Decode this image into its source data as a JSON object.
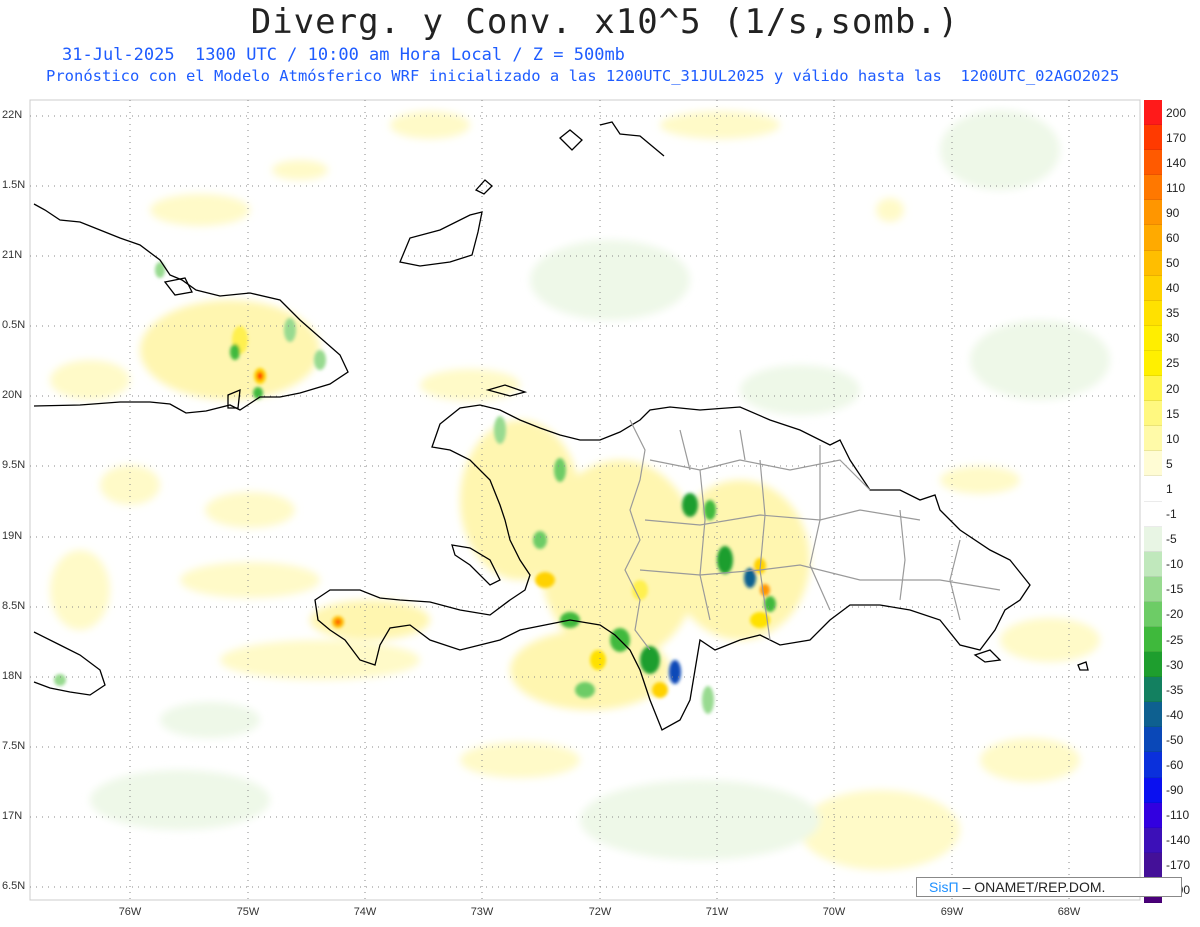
{
  "title": "Diverg. y Conv. x10^5 (1/s,somb.)",
  "subtitle_line1": "31-Jul-2025  1300 UTC / 10:00 am Hora Local / Z = 500mb",
  "subtitle_line2": "Pronóstico con el Modelo Atmósferico WRF inicializado a las 1200UTC_31JUL2025 y válido hasta las  1200UTC_02AGO2025",
  "lat_labels": [
    "22N",
    "1.5N",
    "21N",
    "0.5N",
    "20N",
    "9.5N",
    "19N",
    "8.5N",
    "18N",
    "7.5N",
    "17N",
    "6.5N"
  ],
  "lon_labels": [
    "76W",
    "75W",
    "74W",
    "73W",
    "72W",
    "71W",
    "70W",
    "69W",
    "68W"
  ],
  "colorbar": {
    "labels": [
      "200",
      "170",
      "140",
      "110",
      "90",
      "60",
      "50",
      "40",
      "35",
      "30",
      "25",
      "20",
      "15",
      "10",
      "5",
      "1",
      "-1",
      "-5",
      "-10",
      "-15",
      "-20",
      "-25",
      "-30",
      "-35",
      "-40",
      "-50",
      "-60",
      "-90",
      "-110",
      "-140",
      "-170",
      "-200"
    ],
    "colors": [
      "#ff1a1a",
      "#ff3a00",
      "#ff5a00",
      "#ff7800",
      "#ff9600",
      "#ffaa00",
      "#ffbe00",
      "#ffd200",
      "#ffe100",
      "#ffee00",
      "#fff000",
      "#fff550",
      "#fff880",
      "#fffaa8",
      "#fffcd4",
      "#ffffff",
      "#ffffff",
      "#e8f5e4",
      "#c0e8bc",
      "#98da90",
      "#6dcc66",
      "#3fb93c",
      "#1e9e2e",
      "#138060",
      "#0e6090",
      "#0a48b8",
      "#0a30dc",
      "#0a10f0",
      "#3200e0",
      "#3c10b8",
      "#441098",
      "#4a007a"
    ]
  },
  "credit": {
    "logo": "SisΠ",
    "text": "– ONAMET/REP.DOM."
  }
}
